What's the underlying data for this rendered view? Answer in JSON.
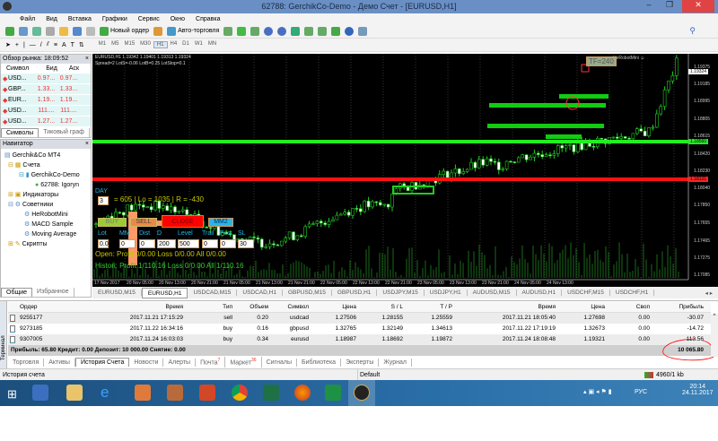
{
  "window": {
    "title": "62788: GerchikCo-Demo - Демо Счет - [EURUSD,H1]"
  },
  "menu": [
    "Файл",
    "Вид",
    "Вставка",
    "Графики",
    "Сервис",
    "Окно",
    "Справка"
  ],
  "toolbar": {
    "new_order": "Новый ордер",
    "auto_trading": "Авто-торговля",
    "timeframes": [
      "M1",
      "M5",
      "M15",
      "M30",
      "H1",
      "H4",
      "D1",
      "W1",
      "MN"
    ],
    "selected_tf": "H1"
  },
  "market_watch": {
    "title": "Обзор рынка: 18:09:52",
    "headers": [
      "Символ",
      "Бид",
      "Аск"
    ],
    "rows": [
      [
        "USD...",
        "0.97...",
        "0.97..."
      ],
      [
        "GBP...",
        "1.33...",
        "1.33..."
      ],
      [
        "EUR...",
        "1.19...",
        "1.19..."
      ],
      [
        "USD...",
        "111....",
        "111...."
      ],
      [
        "USD...",
        "1.27...",
        "1.27..."
      ]
    ],
    "tabs": [
      "Символы",
      "Тиковый граф"
    ]
  },
  "navigator": {
    "title": "Навигатор",
    "root": "Gerchik&Co MT4",
    "accounts": "Счета",
    "server": "GerchikCo-Demo",
    "account": "62788: Igoryn",
    "indicators": "Индикаторы",
    "experts": "Советники",
    "expert_items": [
      "HeRobotMini",
      "MACD Sample",
      "Moving Average"
    ],
    "scripts": "Скрипты",
    "tabs": [
      "Общие",
      "Избранное"
    ]
  },
  "chart": {
    "header": "EURUSD,H1  1.19342 1.19401 1.19313 1.19324",
    "info": "Spread=2  LotS=-0.06  LotB=0.25  LotStop=0.1",
    "ea_name": "HeRobotMini",
    "tf_badge": "TF=240",
    "price_labels": [
      "1.19375",
      "1.19185",
      "1.18995",
      "1.18805",
      "1.18615",
      "1.18420",
      "1.18230",
      "1.18040",
      "1.17850",
      "1.17655",
      "1.17465",
      "1.17275",
      "1.17085"
    ],
    "current_price": "1.19324",
    "green_level": "1.18560",
    "red_level": "1.18131",
    "time_labels": [
      "17 Nov 2017",
      "20 Nov 05:00",
      "20 Nov 13:00",
      "20 Nov 21:00",
      "21 Nov 05:00",
      "21 Nov 13:00",
      "21 Nov 21:00",
      "22 Nov 05:00",
      "22 Nov 13:00",
      "22 Nov 21:00",
      "23 Nov 05:00",
      "23 Nov 13:00",
      "23 Nov 21:00",
      "24 Nov 05:00",
      "24 Nov 13:00"
    ],
    "panel": {
      "day_label": "DAY",
      "day_value": "3",
      "summary": "= 605 | Lo = 1035 | R = -430",
      "buy": "BUY",
      "sell": "SELL",
      "close": "CLOSE",
      "mm2": "MM2",
      "fields": [
        [
          "Lot",
          "0.01"
        ],
        [
          "MM",
          "0"
        ],
        [
          "Dist",
          "0"
        ],
        [
          "D",
          "200"
        ],
        [
          "Level",
          "500"
        ],
        [
          "Trail",
          "0"
        ],
        [
          "First",
          "0"
        ],
        [
          "SL",
          "30"
        ]
      ],
      "open": "Open:  Profit 0/0.00  Loss 0/0.00  All 0/0.00",
      "history": "Histori: Profit 1/110.16  Loss 0/0.00  All 1/110.16"
    }
  },
  "chart_tabs": [
    "EURUSD,M15",
    "EURUSD,H1",
    "USDCAD,M15",
    "USDCAD,H1",
    "GBPUSD,M15",
    "GBPUSD,H1",
    "USDJPY,M15",
    "USDJPY,H1",
    "AUDUSD,M15",
    "AUDUSD,H1",
    "USDCHF,M15",
    "USDCHF,H1"
  ],
  "terminal": {
    "side_label": "Терминал",
    "headers": [
      "Ордер",
      "Время",
      "Тип",
      "Объем",
      "Символ",
      "Цена",
      "S / L",
      "T / P",
      "Время",
      "Цена",
      "Своп",
      "Прибыль"
    ],
    "rows": [
      [
        "9255177",
        "2017.11.21 17:15:29",
        "sell",
        "0.20",
        "usdcad",
        "1.27506",
        "1.28155",
        "1.25559",
        "2017.11.21 18:05:40",
        "1.27698",
        "0.00",
        "-30.07"
      ],
      [
        "9273185",
        "2017.11.22 16:34:16",
        "buy",
        "0.16",
        "gbpusd",
        "1.32765",
        "1.32149",
        "1.34613",
        "2017.11.22 17:19:19",
        "1.32673",
        "0.00",
        "-14.72"
      ],
      [
        "9307005",
        "2017.11.24 16:03:03",
        "buy",
        "0.34",
        "eurusd",
        "1.18987",
        "1.18692",
        "1.19872",
        "2017.11.24 18:08:48",
        "1.19321",
        "0.00",
        "113.56"
      ]
    ],
    "summary": "Прибыль: 65.80  Кредит: 0.00  Депозит: 10 000.00  Снятие: 0.00",
    "total": "10 065.80",
    "tabs": [
      "Торговля",
      "Активы",
      "История Счета",
      "Новости",
      "Алерты",
      "Почта",
      "Маркет",
      "Сигналы",
      "Библиотека",
      "Эксперты",
      "Журнал"
    ],
    "mail_badge": "7",
    "market_badge": "36"
  },
  "status": {
    "left": "История счета",
    "profile": "Default",
    "traffic": "4960/1 kb"
  },
  "taskbar": {
    "lang": "РУС",
    "time": "20:14",
    "date": "24.11.2017"
  }
}
